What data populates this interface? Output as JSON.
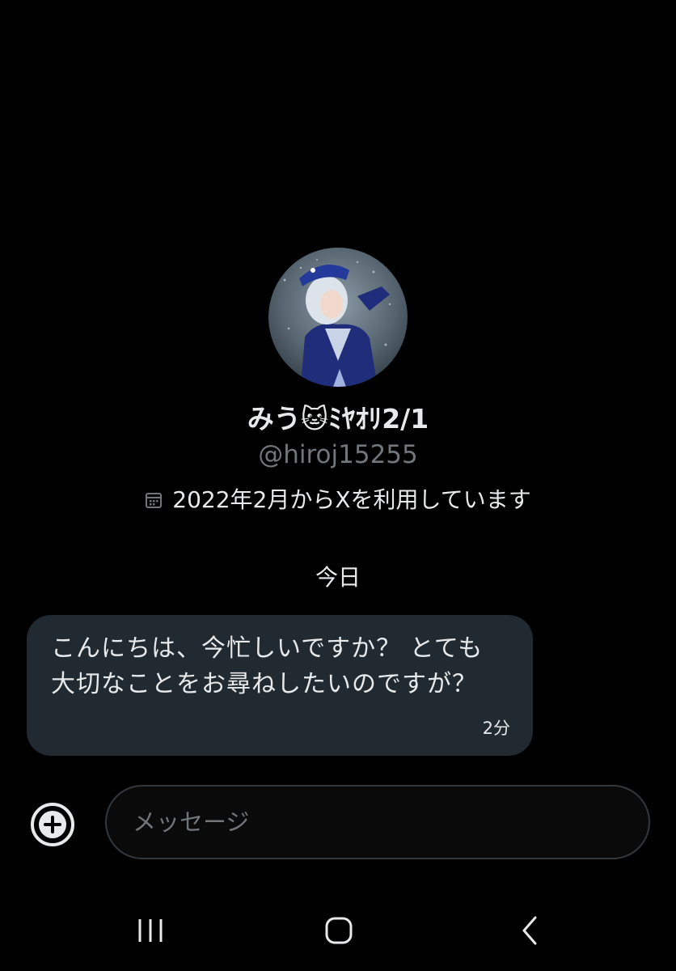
{
  "profile": {
    "display_name": "みう🐱ﾐﾔｵﾘ2/1",
    "handle": "@hiroj15255",
    "joined": "2022年2月からXを利用しています",
    "joined_icon": "calendar-icon",
    "avatar_icon": "profile-photo"
  },
  "conversation": {
    "day_label": "今日",
    "messages": [
      {
        "text": "こんにちは、今忙しいですか？ とても大切なことをお尋ねしたいのですが？",
        "time": "2分"
      }
    ]
  },
  "composer": {
    "add_icon": "plus-circle-icon",
    "placeholder": "メッセージ"
  },
  "system_nav": {
    "recents_icon": "recents-icon",
    "home_icon": "home-icon",
    "back_icon": "back-icon"
  },
  "colors": {
    "background": "#000000",
    "bubble": "#212a31",
    "secondary_text": "#71767b",
    "primary_text": "#e7e9ea"
  }
}
